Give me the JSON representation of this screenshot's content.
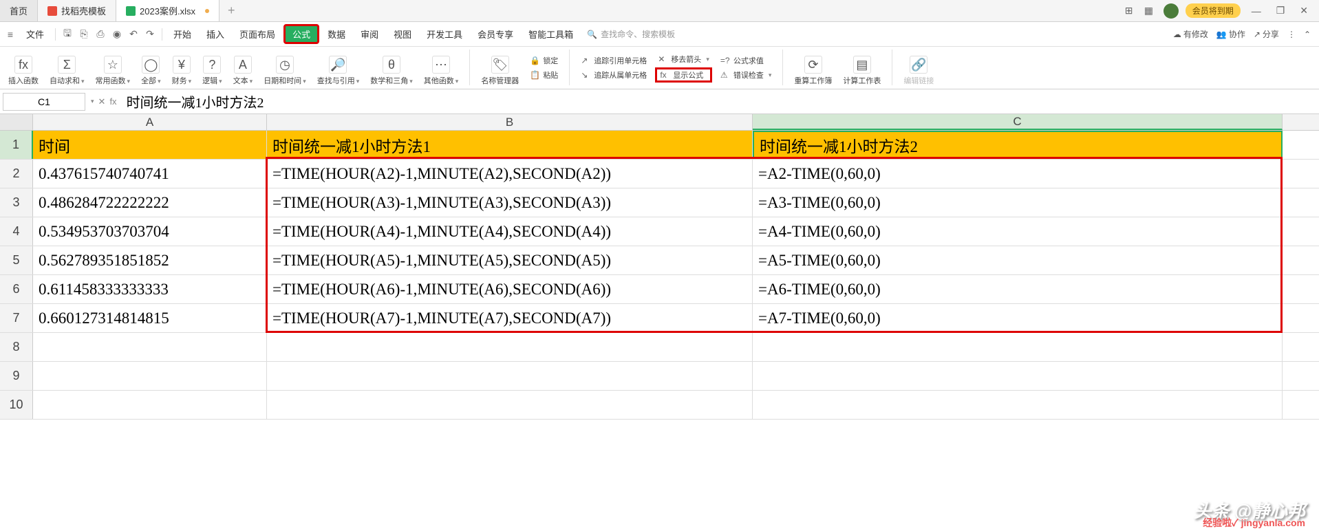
{
  "tabs": {
    "home": "首页",
    "tab1": "找稻壳模板",
    "tab2": "2023案例.xlsx",
    "add": "+"
  },
  "top_right": {
    "vip": "会员将到期",
    "min": "—",
    "restore": "❐",
    "close": "✕"
  },
  "menu": {
    "file": "文件",
    "items": [
      "开始",
      "插入",
      "页面布局",
      "公式",
      "数据",
      "审阅",
      "视图",
      "开发工具",
      "会员专享",
      "智能工具箱"
    ],
    "active_index": 3,
    "search_placeholder": "查找命令、搜索模板",
    "right": {
      "modified": "有修改",
      "collab": "协作",
      "share": "分享"
    }
  },
  "ribbon": {
    "insert_fn": "插入函数",
    "auto_sum": "自动求和",
    "recent": "常用函数",
    "all": "全部",
    "financial": "财务",
    "logical": "逻辑",
    "text": "文本",
    "date_time": "日期和时间",
    "lookup": "查找与引用",
    "math": "数学和三角",
    "other_fn": "其他函数",
    "name_mgr": "名称管理器",
    "paste": "粘贴",
    "trace_prec_title": "追踪引用单元格",
    "trace_dep_title": "追踪从属单元格",
    "remove_arrows": "移去箭头",
    "eval_formula": "公式求值",
    "show_formula": "显示公式",
    "error_check": "错误检查",
    "recalc": "重算工作簿",
    "calc_sheet": "计算工作表",
    "edit_link": "编辑链接",
    "lock": "锁定"
  },
  "formula_bar": {
    "cell_ref": "C1",
    "formula": "时间统一减1小时方法2"
  },
  "columns": [
    "A",
    "B",
    "C"
  ],
  "header_row": {
    "A": "时间",
    "B": "时间统一减1小时方法1",
    "C": "时间统一减1小时方法2"
  },
  "rows": [
    {
      "n": "2",
      "A": "0.437615740740741",
      "B": "=TIME(HOUR(A2)-1,MINUTE(A2),SECOND(A2))",
      "C": "=A2-TIME(0,60,0)"
    },
    {
      "n": "3",
      "A": "0.486284722222222",
      "B": "=TIME(HOUR(A3)-1,MINUTE(A3),SECOND(A3))",
      "C": "=A3-TIME(0,60,0)"
    },
    {
      "n": "4",
      "A": "0.534953703703704",
      "B": "=TIME(HOUR(A4)-1,MINUTE(A4),SECOND(A4))",
      "C": "=A4-TIME(0,60,0)"
    },
    {
      "n": "5",
      "A": "0.562789351851852",
      "B": "=TIME(HOUR(A5)-1,MINUTE(A5),SECOND(A5))",
      "C": "=A5-TIME(0,60,0)"
    },
    {
      "n": "6",
      "A": "0.611458333333333",
      "B": "=TIME(HOUR(A6)-1,MINUTE(A6),SECOND(A6))",
      "C": "=A6-TIME(0,60,0)"
    },
    {
      "n": "7",
      "A": "0.660127314814815",
      "B": "=TIME(HOUR(A7)-1,MINUTE(A7),SECOND(A7))",
      "C": "=A7-TIME(0,60,0)"
    }
  ],
  "empty_rows": [
    "8",
    "9",
    "10"
  ],
  "watermark": "头条 @静心邦",
  "watermark2": "经验啦✓ jingyanla.com"
}
